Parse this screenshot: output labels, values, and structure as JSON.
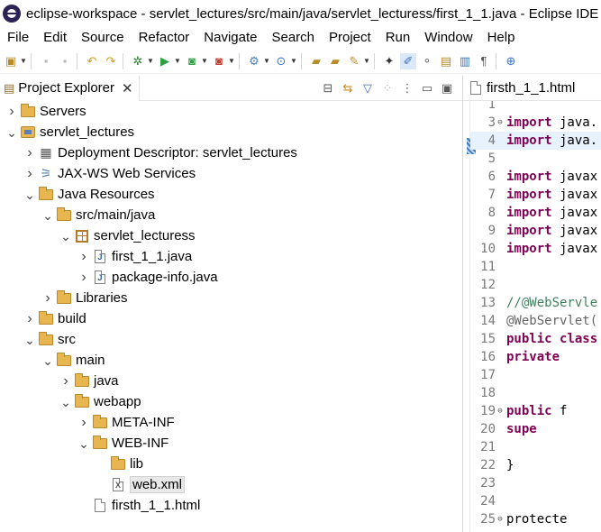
{
  "window": {
    "title": "eclipse-workspace - servlet_lectures/src/main/java/servlet_lecturess/first_1_1.java - Eclipse IDE"
  },
  "menu": [
    "File",
    "Edit",
    "Source",
    "Refactor",
    "Navigate",
    "Search",
    "Project",
    "Run",
    "Window",
    "Help"
  ],
  "toolbar_icons": [
    "new-icon",
    "save-icon",
    "save-all-icon",
    "undo-icon",
    "redo-icon",
    "debug-icon",
    "run-icon",
    "run-config-icon",
    "coverage-icon",
    "new-server-icon",
    "open-type-icon",
    "open-task-icon",
    "search-icon",
    "markers-icon",
    "highlight-icon",
    "toggle-icon",
    "annotation-icon",
    "paragraph-icon",
    "globe-icon"
  ],
  "explorer": {
    "tab_label": "Project Explorer",
    "tree": [
      {
        "label": "Servers",
        "depth": 0,
        "expanded": false,
        "icon": "project-folder-icon"
      },
      {
        "label": "servlet_lectures",
        "depth": 0,
        "expanded": true,
        "icon": "project-icon"
      },
      {
        "label": "Deployment Descriptor: servlet_lectures",
        "depth": 1,
        "expanded": false,
        "icon": "deployment-descriptor-icon"
      },
      {
        "label": "JAX-WS Web Services",
        "depth": 1,
        "expanded": false,
        "icon": "web-services-icon"
      },
      {
        "label": "Java Resources",
        "depth": 1,
        "expanded": true,
        "icon": "java-resources-icon"
      },
      {
        "label": "src/main/java",
        "depth": 2,
        "expanded": true,
        "icon": "source-folder-icon"
      },
      {
        "label": "servlet_lecturess",
        "depth": 3,
        "expanded": true,
        "icon": "package-icon"
      },
      {
        "label": "first_1_1.java",
        "depth": 4,
        "expanded": false,
        "icon": "java-file-icon"
      },
      {
        "label": "package-info.java",
        "depth": 4,
        "expanded": false,
        "icon": "java-file-icon"
      },
      {
        "label": "Libraries",
        "depth": 2,
        "expanded": false,
        "icon": "libraries-icon"
      },
      {
        "label": "build",
        "depth": 1,
        "expanded": false,
        "icon": "folder-icon"
      },
      {
        "label": "src",
        "depth": 1,
        "expanded": true,
        "icon": "folder-icon"
      },
      {
        "label": "main",
        "depth": 2,
        "expanded": true,
        "icon": "folder-icon"
      },
      {
        "label": "java",
        "depth": 3,
        "expanded": false,
        "icon": "folder-icon"
      },
      {
        "label": "webapp",
        "depth": 3,
        "expanded": true,
        "icon": "folder-icon"
      },
      {
        "label": "META-INF",
        "depth": 4,
        "expanded": false,
        "icon": "folder-icon"
      },
      {
        "label": "WEB-INF",
        "depth": 4,
        "expanded": true,
        "icon": "folder-icon"
      },
      {
        "label": "lib",
        "depth": 5,
        "expanded": null,
        "icon": "folder-icon"
      },
      {
        "label": "web.xml",
        "depth": 5,
        "expanded": null,
        "icon": "xml-file-icon",
        "selected": true
      },
      {
        "label": "firsth_1_1.html",
        "depth": 4,
        "expanded": null,
        "icon": "html-file-icon"
      }
    ]
  },
  "editor": {
    "tab_label": "firsth_1_1.html",
    "lines": [
      {
        "num": "1",
        "code": "",
        "fold": ""
      },
      {
        "num": "3",
        "code": "import java.",
        "fold": "⊖"
      },
      {
        "num": "4",
        "code": "import java.",
        "fold": ""
      },
      {
        "num": "5",
        "code": "",
        "fold": ""
      },
      {
        "num": "6",
        "code": "import javax",
        "fold": ""
      },
      {
        "num": "7",
        "code": "import javax",
        "fold": ""
      },
      {
        "num": "8",
        "code": "import javax",
        "fold": ""
      },
      {
        "num": "9",
        "code": "import javax",
        "fold": ""
      },
      {
        "num": "10",
        "code": "import javax",
        "fold": ""
      },
      {
        "num": "11",
        "code": "",
        "fold": ""
      },
      {
        "num": "12",
        "code": "",
        "fold": ""
      },
      {
        "num": "13",
        "code": "//@WebServle",
        "fold": ""
      },
      {
        "num": "14",
        "code": "@WebServlet(",
        "fold": ""
      },
      {
        "num": "15",
        "code": "public class",
        "fold": ""
      },
      {
        "num": "16",
        "code": "    private ",
        "fold": ""
      },
      {
        "num": "17",
        "code": "",
        "fold": ""
      },
      {
        "num": "18",
        "code": "",
        "fold": ""
      },
      {
        "num": "19",
        "code": "    public f",
        "fold": "⊖"
      },
      {
        "num": "20",
        "code": "        supe",
        "fold": ""
      },
      {
        "num": "21",
        "code": "",
        "fold": ""
      },
      {
        "num": "22",
        "code": "    }",
        "fold": ""
      },
      {
        "num": "23",
        "code": "",
        "fold": ""
      },
      {
        "num": "24",
        "code": "",
        "fold": ""
      },
      {
        "num": "25",
        "code": "    protecte",
        "fold": "⊖"
      }
    ]
  }
}
